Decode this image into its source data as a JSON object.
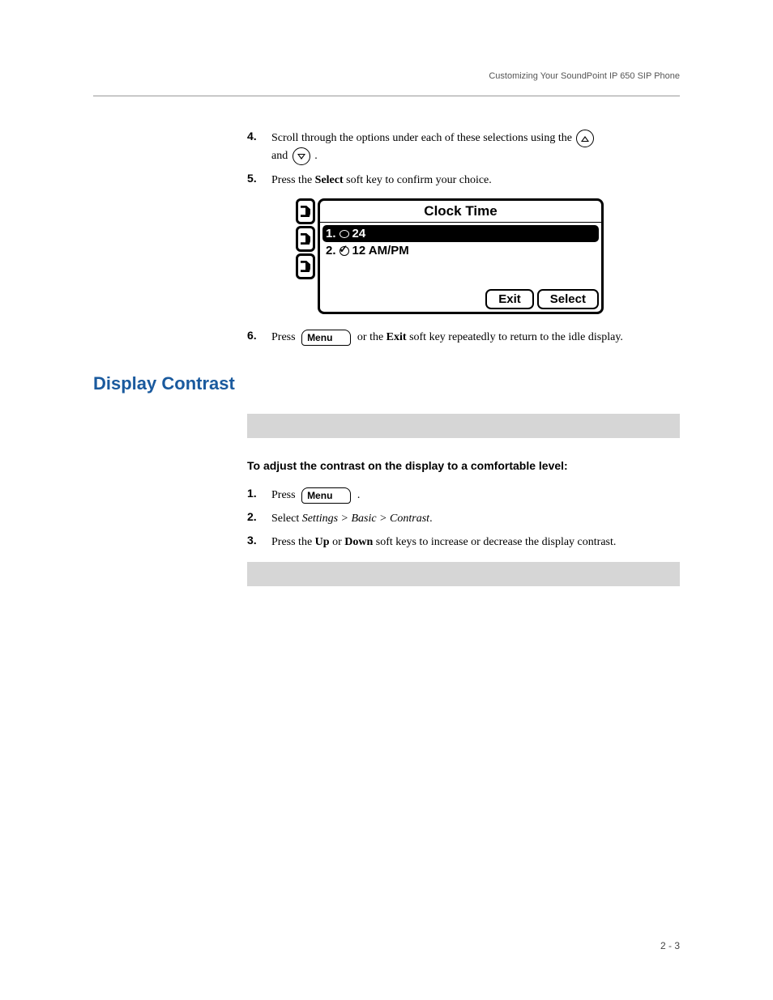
{
  "header": {
    "running_head": "Customizing Your SoundPoint IP 650 SIP Phone"
  },
  "steps_a": {
    "s4": {
      "num": "4.",
      "pre": "Scroll through the options under each of these selections using the ",
      "mid": "and ",
      "post": " ."
    },
    "s5": {
      "num": "5.",
      "pre": "Press the ",
      "bold": "Select",
      "post": " soft key to confirm your choice."
    },
    "s6": {
      "num": "6.",
      "pre": "Press ",
      "mid": " or the ",
      "bold": "Exit",
      "post": " soft key repeatedly to return to the idle display."
    }
  },
  "lcd": {
    "title": "Clock Time",
    "opt1_num": "1.",
    "opt1_label": "24",
    "opt2_num": "2.",
    "opt2_label": "12 AM/PM",
    "softkey_exit": "Exit",
    "softkey_select": "Select"
  },
  "menu_key_label": "Menu",
  "section": {
    "title": "Display Contrast",
    "subhead": "To adjust the contrast on the display to a comfortable level:"
  },
  "steps_b": {
    "s1": {
      "num": "1.",
      "pre": "Press ",
      "post": " ."
    },
    "s2": {
      "num": "2.",
      "pre": "Select ",
      "ital": "Settings > Basic > Contrast",
      "post": "."
    },
    "s3": {
      "num": "3.",
      "pre": "Press the ",
      "b1": "Up",
      "mid": " or ",
      "b2": "Down",
      "post": " soft keys to increase or decrease the display contrast."
    }
  },
  "footer": {
    "page": "2 - 3"
  }
}
